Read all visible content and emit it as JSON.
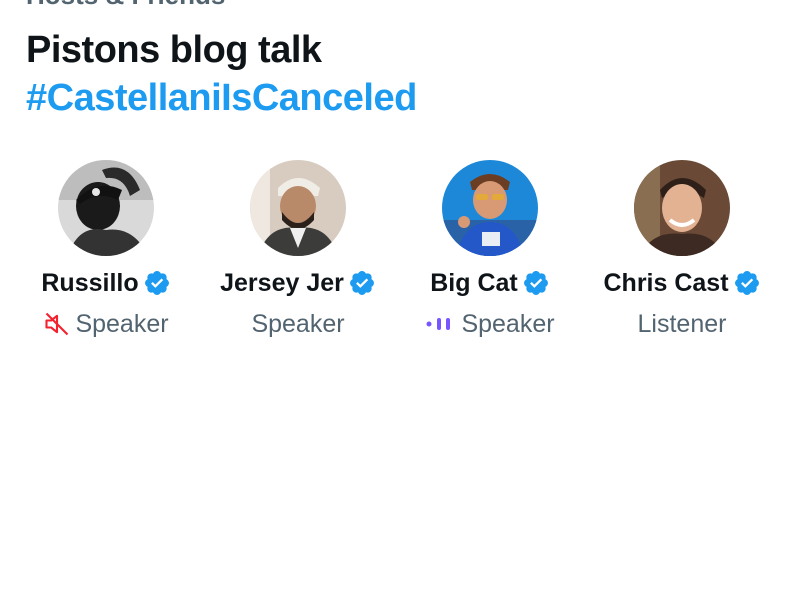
{
  "space": {
    "clipped_top_text": "Hosts & Friends",
    "title": "Pistons blog talk",
    "hashtag": "#CastellaniIsCanceled"
  },
  "colors": {
    "accent": "#1d9bf0",
    "muted_text": "#536471",
    "muted_icon": "#f4212e",
    "speaking_indicator": "#7856ff"
  },
  "participants": [
    {
      "name": "Russillo",
      "verified": true,
      "role": "Speaker",
      "status_icon": "microphone-muted-icon"
    },
    {
      "name": "Jersey Jer",
      "verified": true,
      "role": "Speaker",
      "status_icon": ""
    },
    {
      "name": "Big Cat",
      "verified": true,
      "role": "Speaker",
      "status_icon": "speaking-waveform-icon"
    },
    {
      "name": "Chris Cast",
      "verified": true,
      "role": "Listener",
      "status_icon": ""
    }
  ]
}
